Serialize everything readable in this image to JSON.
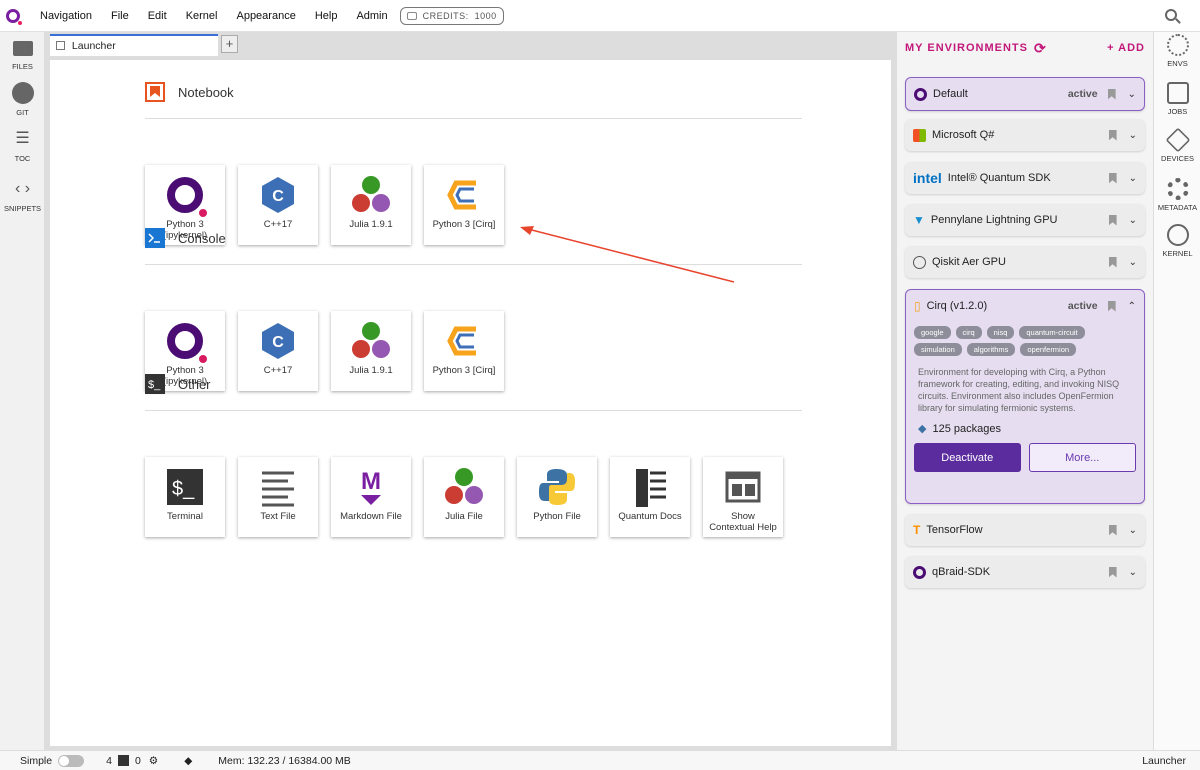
{
  "menubar": {
    "items": [
      "Navigation",
      "File",
      "Edit",
      "Kernel",
      "Appearance",
      "Help",
      "Admin"
    ],
    "credits_label": "CREDITS:",
    "credits_value": "1000"
  },
  "leftbar": {
    "items": [
      "FILES",
      "GIT",
      "TOC",
      "SNIPPETS"
    ]
  },
  "tabs": {
    "launcher": "Launcher",
    "new_tab": "+"
  },
  "launcher": {
    "notebook": {
      "title": "Notebook",
      "cards": [
        "Python 3\n(ipykernel)",
        "C++17",
        "Julia 1.9.1",
        "Python 3 [Cirq]"
      ]
    },
    "console": {
      "title": "Console",
      "cards": [
        "Python 3\n(ipykernel)",
        "C++17",
        "Julia 1.9.1",
        "Python 3 [Cirq]"
      ]
    },
    "other": {
      "title": "Other",
      "cards": [
        "Terminal",
        "Text File",
        "Markdown File",
        "Julia File",
        "Python File",
        "Quantum Docs",
        "Show\nContextual Help"
      ]
    }
  },
  "environments": {
    "title": "MY ENVIRONMENTS",
    "add_label": "+ ADD",
    "items": [
      {
        "name": "Default",
        "status": "active"
      },
      {
        "name": "Microsoft Q#",
        "status": ""
      },
      {
        "name": "Intel® Quantum SDK",
        "status": "",
        "brand": "intel"
      },
      {
        "name": "Pennylane Lightning GPU",
        "status": ""
      },
      {
        "name": "Qiskit Aer GPU",
        "status": ""
      },
      {
        "name": "Cirq (v1.2.0)",
        "status": "active"
      },
      {
        "name": "TensorFlow",
        "status": ""
      },
      {
        "name": "qBraid-SDK",
        "status": ""
      }
    ],
    "expanded": {
      "tags": [
        "google",
        "cirq",
        "nisq",
        "quantum-circuit",
        "simulation",
        "algorithms",
        "openfermion"
      ],
      "description": "Environment for developing with Cirq, a Python framework for creating, editing, and invoking NISQ circuits. Environment also includes OpenFermion library for simulating fermionic systems.",
      "packages": "125 packages",
      "deactivate_label": "Deactivate",
      "more_label": "More..."
    }
  },
  "rightbar": {
    "items": [
      "ENVS",
      "JOBS",
      "DEVICES",
      "METADATA",
      "KERNEL"
    ]
  },
  "statusbar": {
    "mode": "Simple",
    "terminals": "4",
    "kernels": "0",
    "memory": "Mem: 132.23 / 16384.00 MB",
    "right": "Launcher"
  },
  "colors": {
    "accent": "#c2187a",
    "env_purple": "#5b2c9e",
    "tab_blue": "#3a6fd8"
  }
}
